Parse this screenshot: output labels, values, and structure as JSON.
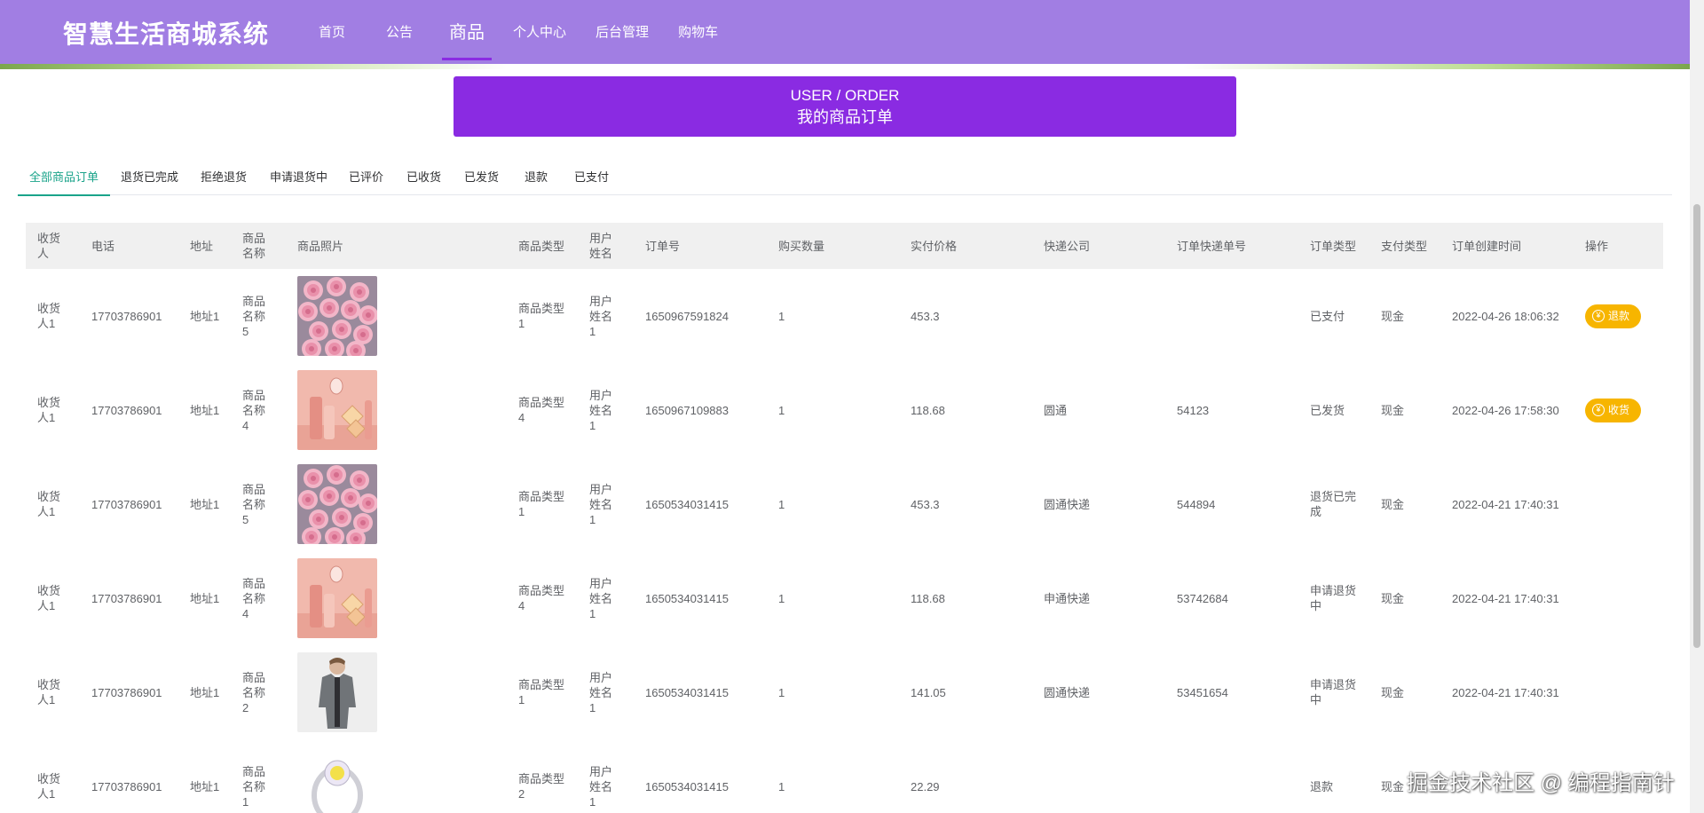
{
  "brand": "智慧生活商城系统",
  "nav": [
    {
      "label": "首页"
    },
    {
      "label": "公告"
    },
    {
      "label": "商品",
      "active": true
    },
    {
      "label": "个人中心"
    },
    {
      "label": "后台管理"
    },
    {
      "label": "购物车"
    }
  ],
  "banner": {
    "en": "USER / ORDER",
    "cn": "我的商品订单"
  },
  "tabs": [
    "全部商品订单",
    "退货已完成",
    "拒绝退货",
    "申请退货中",
    "已评价",
    "已收货",
    "已发货",
    "退款",
    "已支付"
  ],
  "table": {
    "headers": [
      "收货人",
      "电话",
      "地址",
      "商品名称",
      "商品照片",
      "商品类型",
      "用户姓名",
      "订单号",
      "购买数量",
      "实付价格",
      "快递公司",
      "订单快递单号",
      "订单类型",
      "支付类型",
      "订单创建时间",
      "操作"
    ],
    "rows": [
      {
        "consignee": "收货人1",
        "phone": "17703786901",
        "address": "地址1",
        "product": "商品名称5",
        "photo": "roses",
        "type": "商品类型1",
        "user": "用户姓名1",
        "order_no": "1650967591824",
        "qty": "1",
        "price": "453.3",
        "courier": "",
        "tracking": "",
        "order_type": "已支付",
        "pay_type": "现金",
        "created": "2022-04-26 18:06:32",
        "action": "退款"
      },
      {
        "consignee": "收货人1",
        "phone": "17703786901",
        "address": "地址1",
        "product": "商品名称4",
        "photo": "cosmetics",
        "type": "商品类型4",
        "user": "用户姓名1",
        "order_no": "1650967109883",
        "qty": "1",
        "price": "118.68",
        "courier": "圆通",
        "tracking": "54123",
        "order_type": "已发货",
        "pay_type": "现金",
        "created": "2022-04-26 17:58:30",
        "action": "收货"
      },
      {
        "consignee": "收货人1",
        "phone": "17703786901",
        "address": "地址1",
        "product": "商品名称5",
        "photo": "roses",
        "type": "商品类型1",
        "user": "用户姓名1",
        "order_no": "1650534031415",
        "qty": "1",
        "price": "453.3",
        "courier": "圆通快递",
        "tracking": "544894",
        "order_type": "退货已完成",
        "pay_type": "现金",
        "created": "2022-04-21 17:40:31",
        "action": ""
      },
      {
        "consignee": "收货人1",
        "phone": "17703786901",
        "address": "地址1",
        "product": "商品名称4",
        "photo": "cosmetics",
        "type": "商品类型4",
        "user": "用户姓名1",
        "order_no": "1650534031415",
        "qty": "1",
        "price": "118.68",
        "courier": "申通快递",
        "tracking": "53742684",
        "order_type": "申请退货中",
        "pay_type": "现金",
        "created": "2022-04-21 17:40:31",
        "action": ""
      },
      {
        "consignee": "收货人1",
        "phone": "17703786901",
        "address": "地址1",
        "product": "商品名称2",
        "photo": "jacket",
        "type": "商品类型1",
        "user": "用户姓名1",
        "order_no": "1650534031415",
        "qty": "1",
        "price": "141.05",
        "courier": "圆通快递",
        "tracking": "53451654",
        "order_type": "申请退货中",
        "pay_type": "现金",
        "created": "2022-04-21 17:40:31",
        "action": ""
      },
      {
        "consignee": "收货人1",
        "phone": "17703786901",
        "address": "地址1",
        "product": "商品名称1",
        "photo": "ring",
        "type": "商品类型2",
        "user": "用户姓名1",
        "order_no": "1650534031415",
        "qty": "1",
        "price": "22.29",
        "courier": "",
        "tracking": "",
        "order_type": "退款",
        "pay_type": "现金",
        "created": "",
        "action": ""
      }
    ]
  },
  "watermark": "掘金技术社区 @ 编程指南针",
  "colors": {
    "topbar": "#a17ee3",
    "banner": "#8a2be2",
    "tab_active": "#1aa38a",
    "action_button": "#f7b500"
  }
}
